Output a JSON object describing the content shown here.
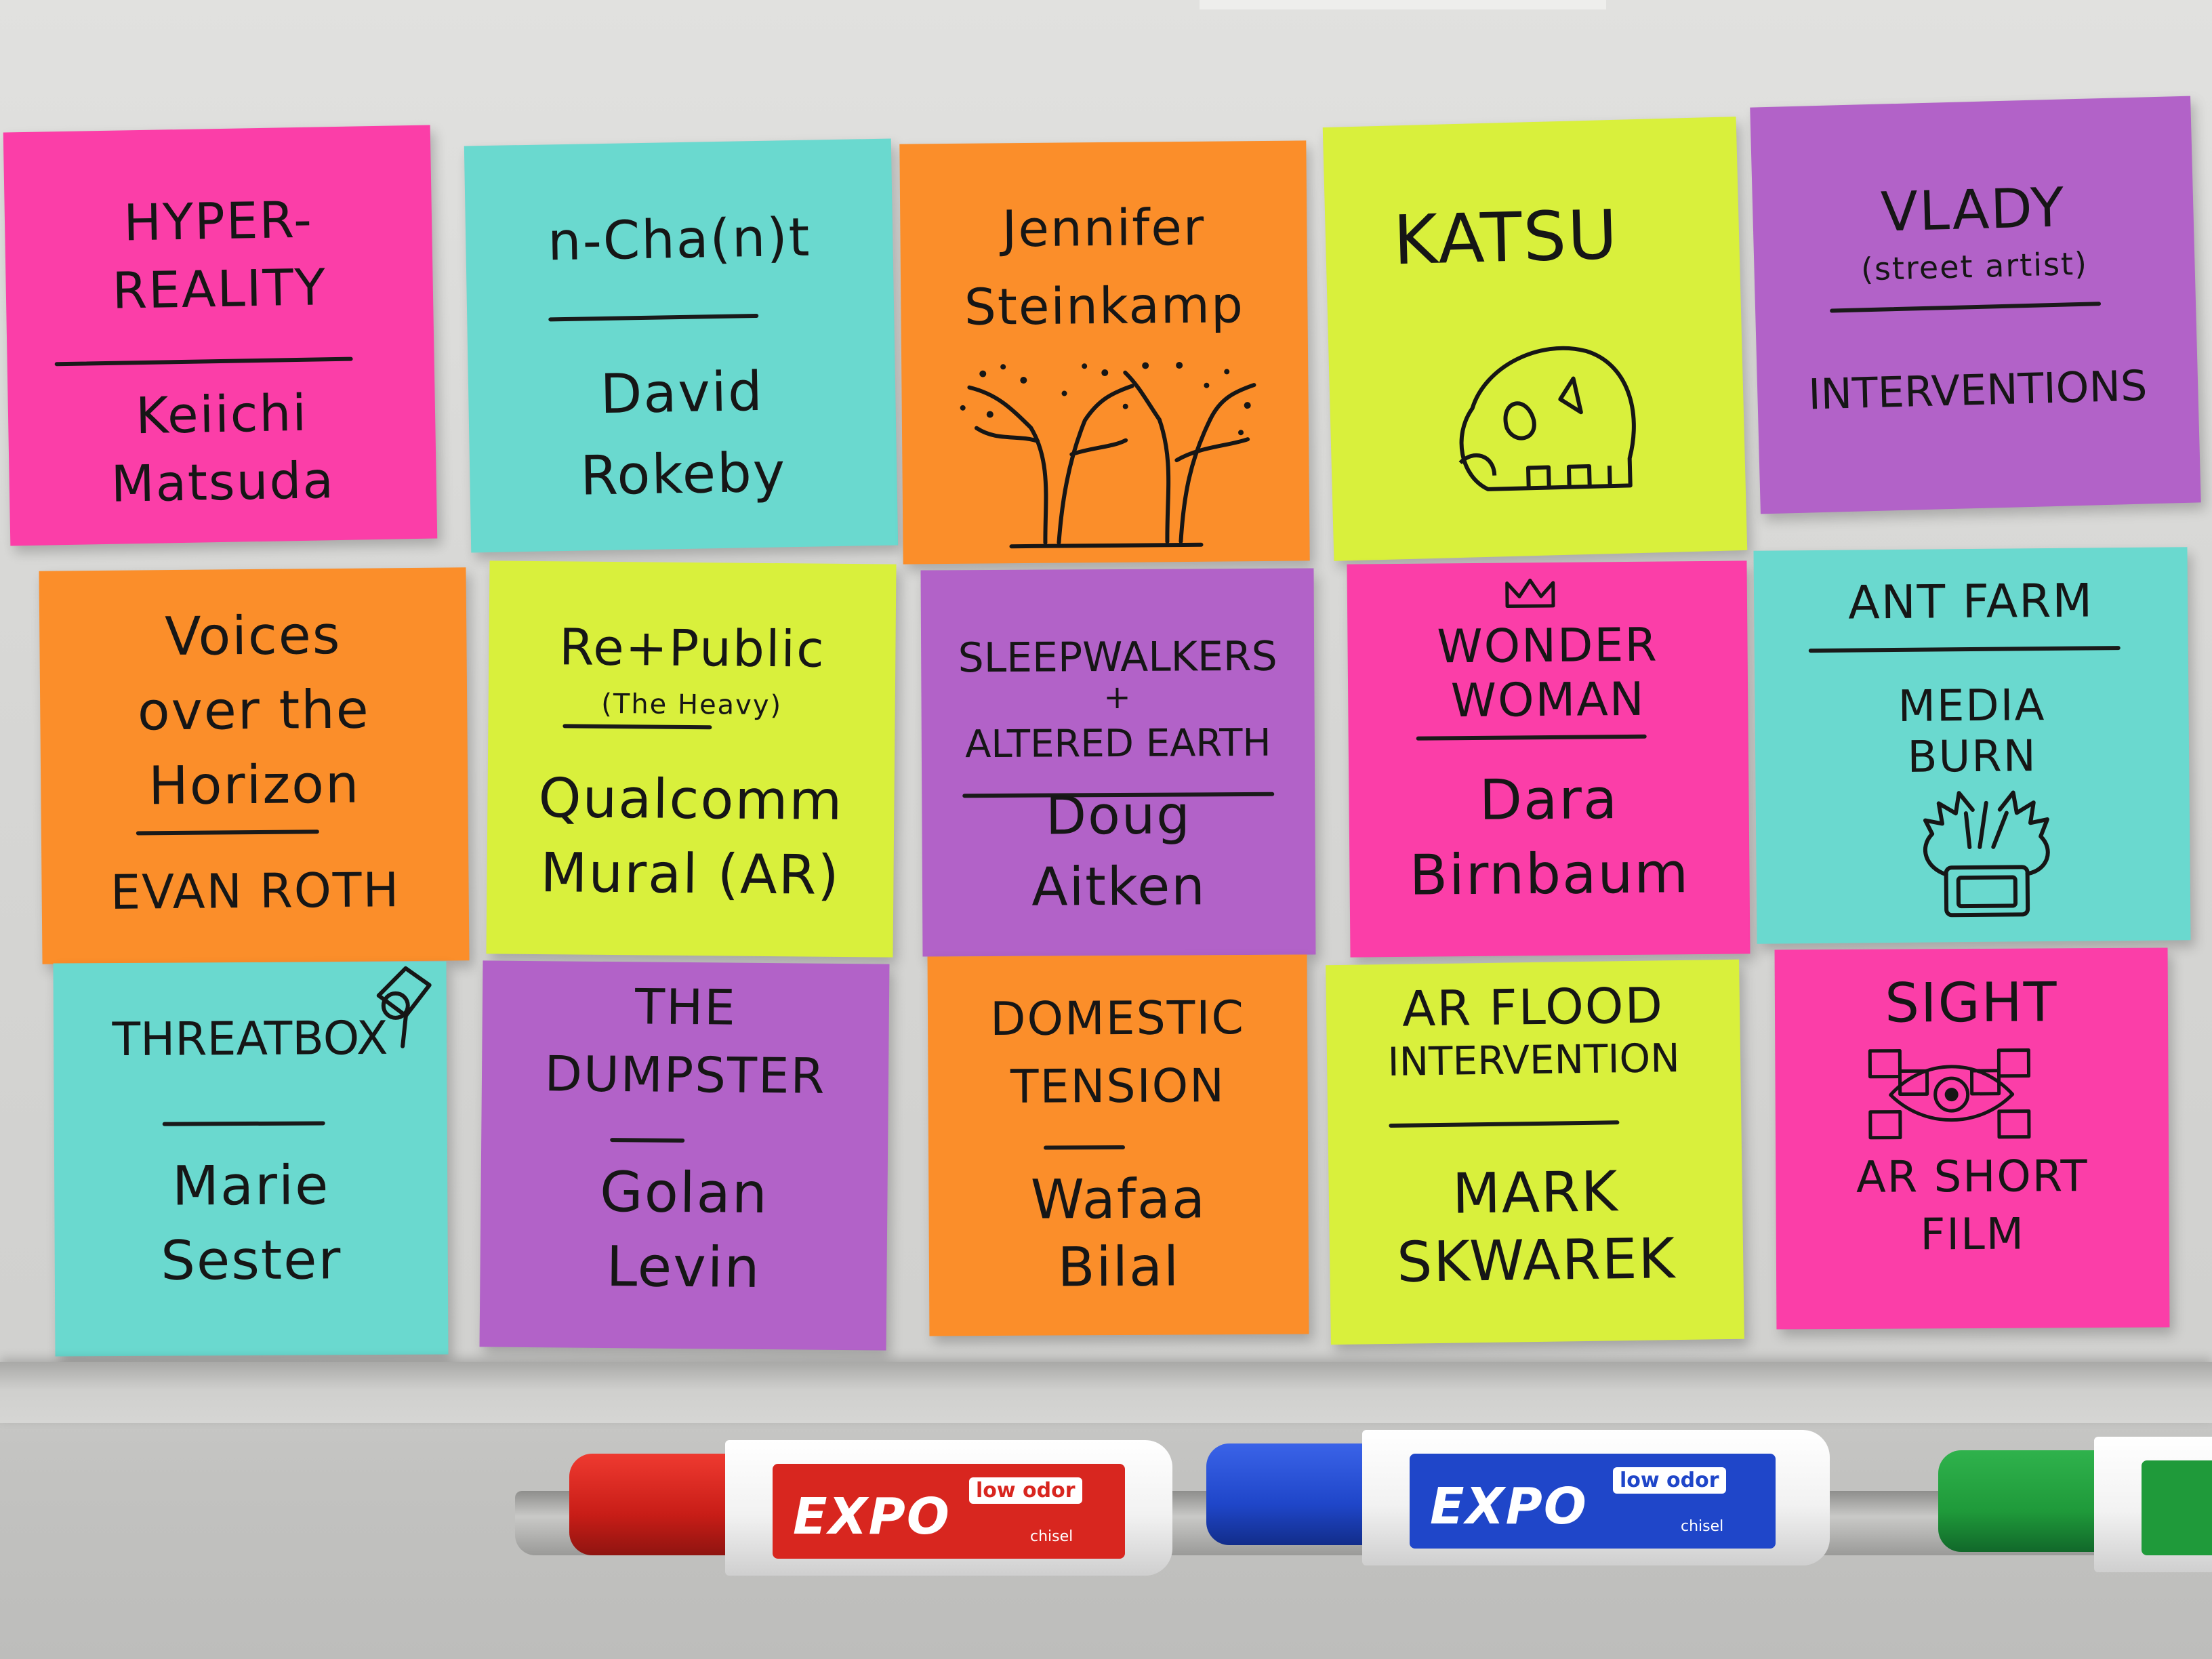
{
  "board": {
    "background_color": "#d9d9d7",
    "note_colors": {
      "pink": "#fb3ea8",
      "cyan": "#6ad9cf",
      "orange": "#fb8e2a",
      "lime": "#d9f03c",
      "purple": "#b262c8"
    },
    "notes": [
      {
        "color": "pink",
        "lines": [
          "HYPER-",
          "REALITY",
          "Keiichi",
          "Matsuda"
        ]
      },
      {
        "color": "cyan",
        "lines": [
          "n-Cha(n)t",
          "David",
          "Rokeby"
        ]
      },
      {
        "color": "orange",
        "lines": [
          "Jennifer",
          "Steinkamp"
        ],
        "sketch": "trees-icon"
      },
      {
        "color": "lime",
        "lines": [
          "KATSU"
        ],
        "sketch": "skull-icon"
      },
      {
        "color": "purple",
        "lines": [
          "VLADY",
          "(street artist)",
          "INTERVENTIONS"
        ]
      },
      {
        "color": "orange",
        "lines": [
          "Voices",
          "over the",
          "Horizon",
          "EVAN ROTH"
        ]
      },
      {
        "color": "lime",
        "lines": [
          "Re+Public",
          "(The Heavy)",
          "Qualcomm",
          "Mural (AR)"
        ]
      },
      {
        "color": "purple",
        "lines": [
          "SLEEPWALKERS",
          "+",
          "ALTERED EARTH",
          "Doug",
          "Aitken"
        ]
      },
      {
        "color": "pink",
        "lines": [
          "WONDER",
          "WOMAN",
          "Dara",
          "Birnbaum"
        ],
        "sketch": "crown-icon"
      },
      {
        "color": "cyan",
        "lines": [
          "ANT FARM",
          "MEDIA",
          "BURN"
        ],
        "sketch": "burning-tv-icon"
      },
      {
        "color": "cyan",
        "lines": [
          "THREATBOX",
          "Marie",
          "Sester"
        ],
        "sketch": "camera-icon"
      },
      {
        "color": "purple",
        "lines": [
          "THE",
          "DUMPSTER",
          "Golan",
          "Levin"
        ]
      },
      {
        "color": "orange",
        "lines": [
          "DOMESTIC",
          "TENSION",
          "Wafaa",
          "Bilal"
        ]
      },
      {
        "color": "lime",
        "lines": [
          "AR FLOOD",
          "INTERVENTION",
          "MARK",
          "SKWAREK"
        ]
      },
      {
        "color": "pink",
        "lines": [
          "SIGHT",
          "AR SHORT",
          "FILM"
        ],
        "sketch": "eye-icon"
      }
    ]
  },
  "markers": [
    {
      "color": "red",
      "cap_color": "#d8261f",
      "brand": "EXPO",
      "tag": "low odor",
      "sub": "chisel"
    },
    {
      "color": "blue",
      "cap_color": "#1f46c9",
      "brand": "EXPO",
      "tag": "low odor",
      "sub": "chisel"
    },
    {
      "color": "green",
      "cap_color": "#1f9a3a"
    }
  ]
}
